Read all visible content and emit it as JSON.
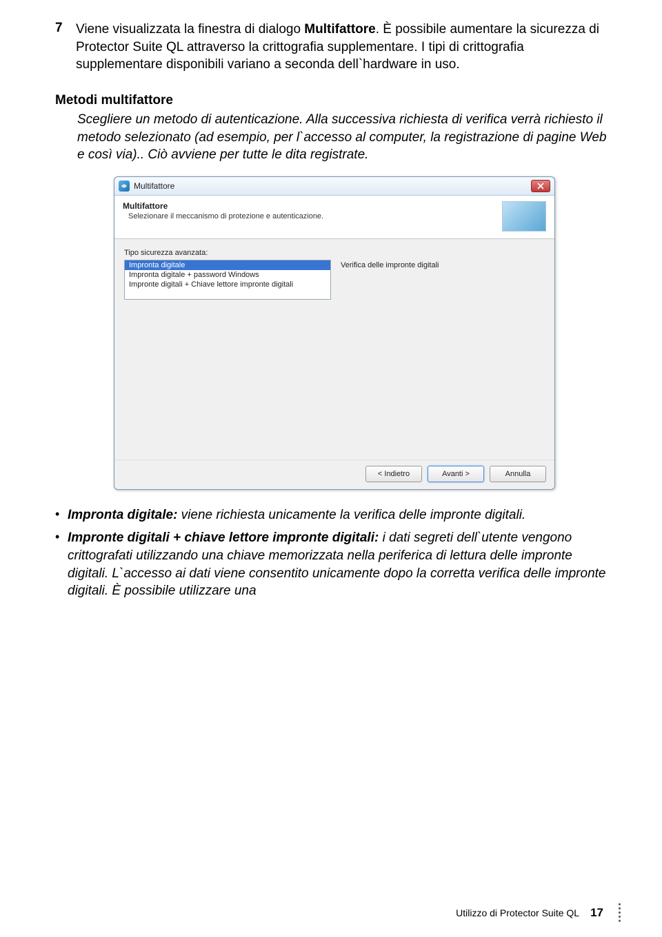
{
  "step": {
    "number": "7",
    "text_before": "Viene visualizzata la finestra di dialogo ",
    "bold": "Multifattore",
    "text_after": ". È possibile aumentare la sicurezza di Protector Suite QL attraverso la crittografia supplementare. I tipi di crittografia supplementare disponibili variano a seconda dell`hardware in uso."
  },
  "section": {
    "title": "Metodi multifattore",
    "body": "Scegliere un metodo di autenticazione. Alla successiva richiesta di verifica verrà richiesto il metodo selezionato (ad esempio, per l`accesso al computer, la registrazione di pagine Web e così via).. Ciò avviene per tutte le dita registrate."
  },
  "dialog": {
    "app_title": "Multifattore",
    "header_title": "Multifattore",
    "header_sub": "Selezionare il meccanismo di protezione e autenticazione.",
    "label_above_list": "Tipo sicurezza avanzata:",
    "list": [
      "Impronta digitale",
      "Impronta digitale + password Windows",
      "Impronte digitali + Chiave lettore impronte digitali"
    ],
    "right_text": "Verifica delle impronte digitali",
    "buttons": {
      "back": "< Indietro",
      "next": "Avanti >",
      "cancel": "Annulla"
    }
  },
  "bullets": [
    {
      "lead": "Impronta digitale:",
      "rest": " viene richiesta unicamente la verifica delle impronte digitali."
    },
    {
      "lead": "Impronte digitali + chiave lettore impronte digitali:",
      "rest": " i dati segreti dell`utente vengono crittografati utilizzando una chiave memorizzata nella periferica di lettura delle impronte digitali. L`accesso ai dati viene consentito unicamente dopo la corretta verifica delle impronte digitali. È possibile utilizzare una"
    }
  ],
  "footer": {
    "text": "Utilizzo di Protector Suite QL",
    "page": "17"
  }
}
